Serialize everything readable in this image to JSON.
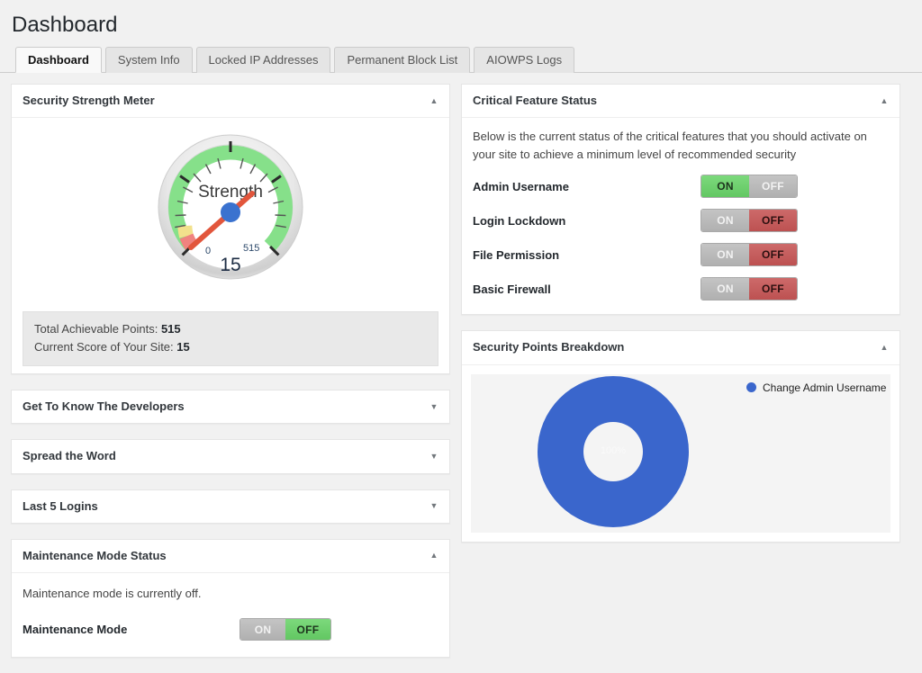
{
  "page": {
    "title": "Dashboard"
  },
  "tabs": [
    {
      "label": "Dashboard",
      "active": true
    },
    {
      "label": "System Info",
      "active": false
    },
    {
      "label": "Locked IP Addresses",
      "active": false
    },
    {
      "label": "Permanent Block List",
      "active": false
    },
    {
      "label": "AIOWPS Logs",
      "active": false
    }
  ],
  "security_strength_meter": {
    "title": "Security Strength Meter",
    "toggle_icon": "chevron-up-icon",
    "gauge": {
      "center_label": "Strength",
      "min_label": "0",
      "max_label": "515",
      "value_label": "15"
    },
    "total_points_label": "Total Achievable Points:",
    "total_points_value": "515",
    "current_score_label": "Current Score of Your Site:",
    "current_score_value": "15"
  },
  "collapsed_panels": [
    {
      "title": "Get To Know The Developers",
      "toggle_icon": "chevron-down-icon"
    },
    {
      "title": "Spread the Word",
      "toggle_icon": "chevron-down-icon"
    },
    {
      "title": "Last 5 Logins",
      "toggle_icon": "chevron-down-icon"
    }
  ],
  "maintenance": {
    "title": "Maintenance Mode Status",
    "toggle_icon": "chevron-up-icon",
    "status_text": "Maintenance mode is currently off.",
    "row_label": "Maintenance Mode",
    "on_label": "ON",
    "off_label": "OFF",
    "state": "off"
  },
  "critical_features": {
    "title": "Critical Feature Status",
    "toggle_icon": "chevron-up-icon",
    "description": "Below is the current status of the critical features that you should activate on your site to achieve a minimum level of recommended security",
    "on_label": "ON",
    "off_label": "OFF",
    "rows": [
      {
        "label": "Admin Username",
        "state": "on"
      },
      {
        "label": "Login Lockdown",
        "state": "off"
      },
      {
        "label": "File Permission",
        "state": "off"
      },
      {
        "label": "Basic Firewall",
        "state": "off"
      }
    ]
  },
  "points_breakdown": {
    "title": "Security Points Breakdown",
    "toggle_icon": "chevron-up-icon"
  },
  "colors": {
    "accent_blue": "#3a66cc",
    "toggle_green": "#6ed06e",
    "toggle_red": "#c55c5c",
    "toggle_gray": "#b8b8b8",
    "page_background": "#f1f1f1"
  },
  "chart_data": {
    "type": "pie",
    "title": "Security Points Breakdown",
    "subtitle": "",
    "donut": true,
    "center_label": "100%",
    "legend_position": "right",
    "labels": [
      "Change Admin Username"
    ],
    "values": [
      100
    ],
    "value_unit": "%",
    "series_colors": [
      "#3a66cc"
    ]
  },
  "gauge_data": {
    "type": "gauge",
    "title": "Security Strength Meter",
    "label": "Strength",
    "value": 15,
    "min": 0,
    "max": 515,
    "bands": [
      {
        "from": 0,
        "to": 10,
        "color": "#f08080"
      },
      {
        "from": 10,
        "to": 40,
        "color": "#f2e18c"
      },
      {
        "from": 40,
        "to": 515,
        "color": "#86e08a"
      }
    ]
  }
}
